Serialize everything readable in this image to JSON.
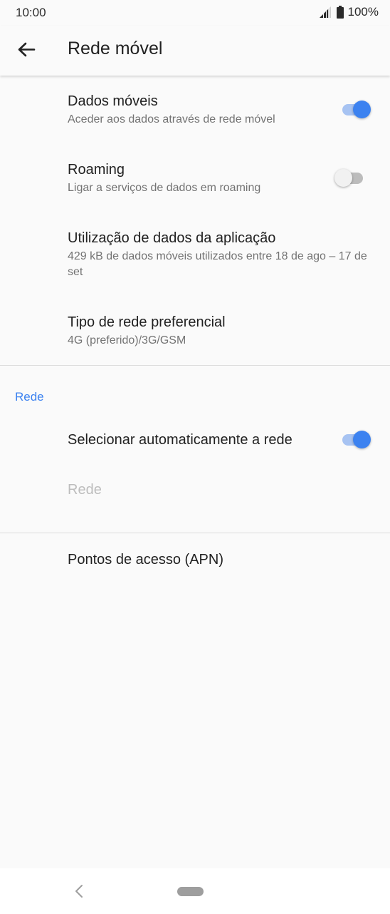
{
  "status_bar": {
    "time": "10:00",
    "battery": "100%"
  },
  "header": {
    "title": "Rede móvel"
  },
  "settings": {
    "mobile_data": {
      "title": "Dados móveis",
      "summary": "Aceder aos dados através de rede móvel",
      "enabled": true
    },
    "roaming": {
      "title": "Roaming",
      "summary": "Ligar a serviços de dados em roaming",
      "enabled": false
    },
    "app_data_usage": {
      "title": "Utilização de dados da aplicação",
      "summary": "429 kB de dados móveis utilizados entre 18 de ago – 17 de set"
    },
    "preferred_network": {
      "title": "Tipo de rede preferencial",
      "summary": "4G (preferido)/3G/GSM"
    }
  },
  "network_section": {
    "header": "Rede",
    "auto_select": {
      "title": "Selecionar automaticamente a rede",
      "enabled": true
    },
    "network": {
      "title": "Rede"
    }
  },
  "apn": {
    "title": "Pontos de acesso (APN)"
  },
  "colors": {
    "accent": "#3c82f0",
    "track_on": "#a7c3f2",
    "background": "#fafafa"
  },
  "icons": {
    "back": "arrow-left-icon",
    "signal": "signal-icon",
    "battery": "battery-icon",
    "nav_back": "chevron-left-icon",
    "nav_home": "home-pill-icon"
  }
}
